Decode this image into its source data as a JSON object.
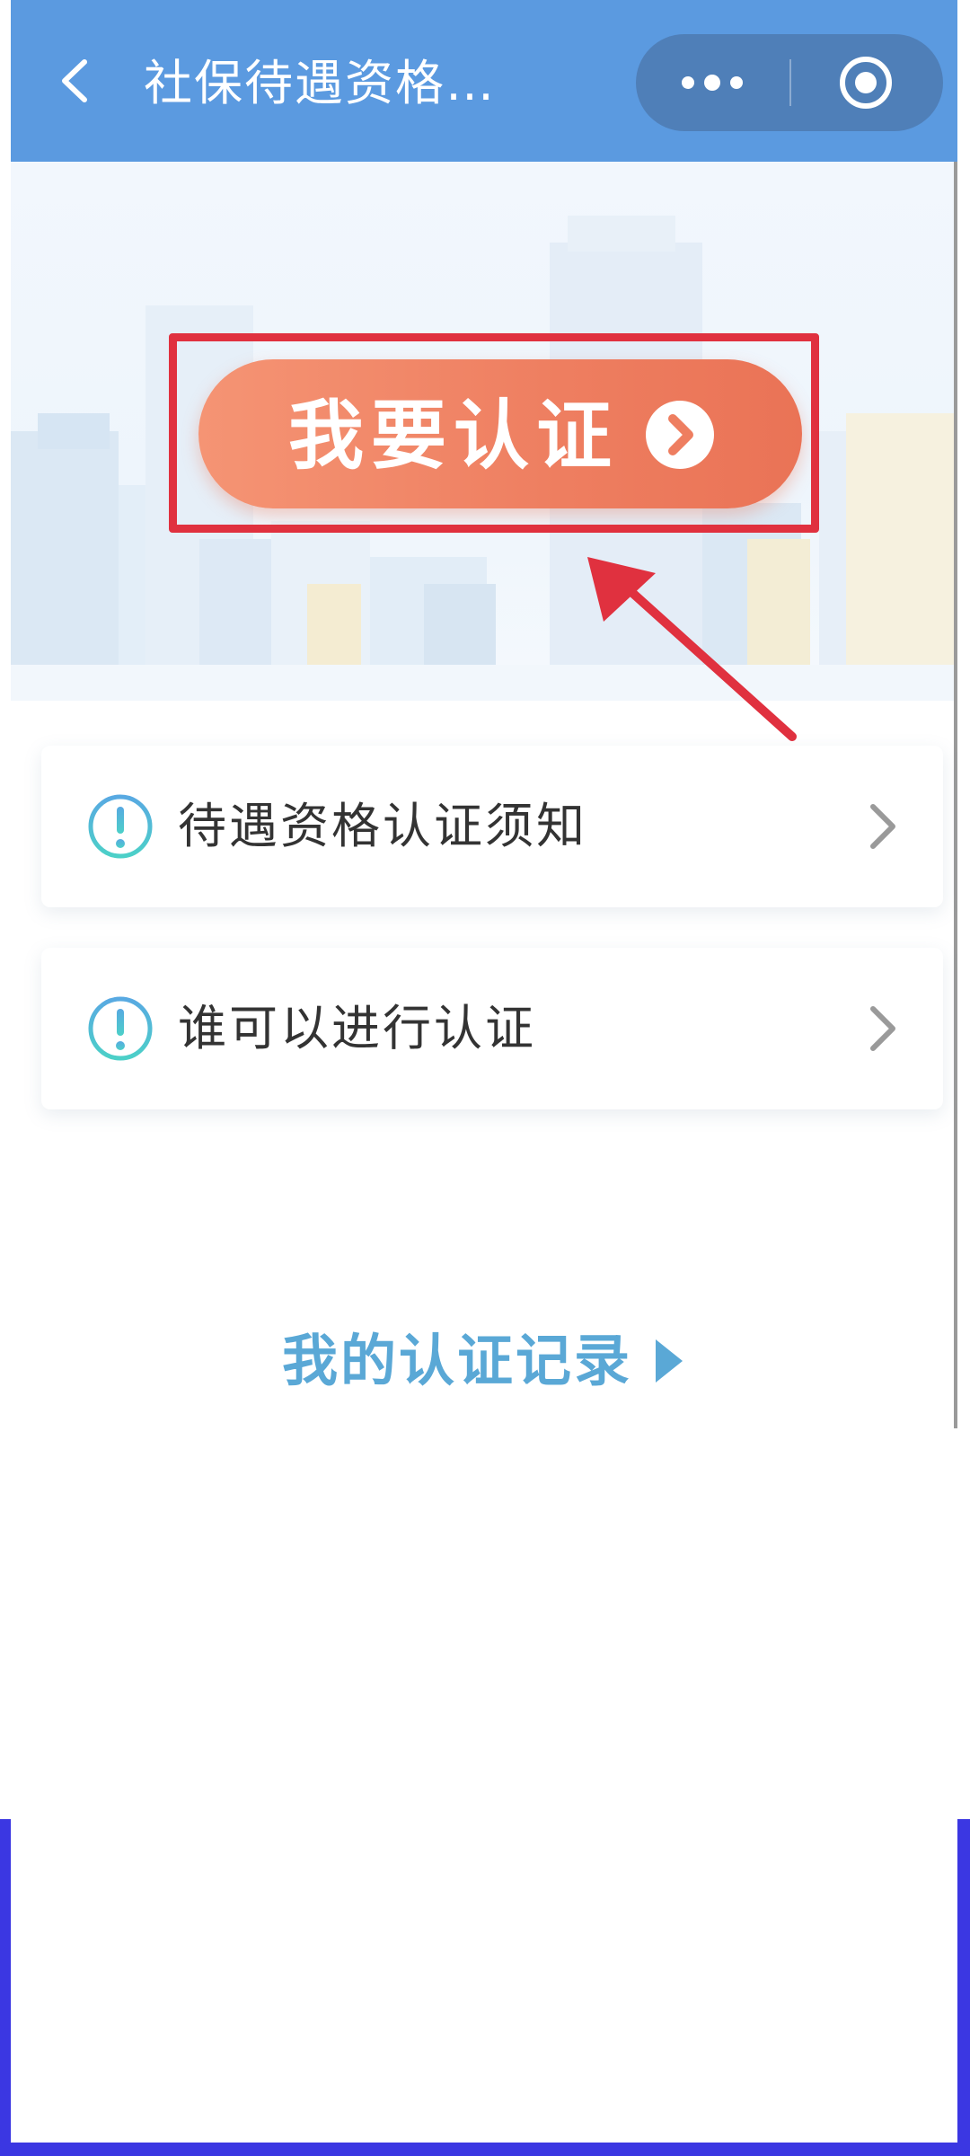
{
  "nav": {
    "title": "社保待遇资格…",
    "back_icon": "chevron-left-icon",
    "more_icon": "more-dots-icon",
    "close_icon": "target-circle-icon"
  },
  "hero": {
    "primary_button_label": "我要认证",
    "primary_button_icon": "arrow-circle-right-icon",
    "highlight_color": "#e0313f",
    "button_color": "#ee7e60"
  },
  "menu": {
    "items": [
      {
        "label": "待遇资格认证须知",
        "icon": "info-circle-icon"
      },
      {
        "label": "谁可以进行认证",
        "icon": "info-circle-icon"
      }
    ]
  },
  "records_link": {
    "label": "我的认证记录",
    "icon": "caret-right-icon",
    "color": "#5aa8d6"
  },
  "theme": {
    "nav_color": "#5b9ae0",
    "frame_color": "#3b37e2"
  }
}
